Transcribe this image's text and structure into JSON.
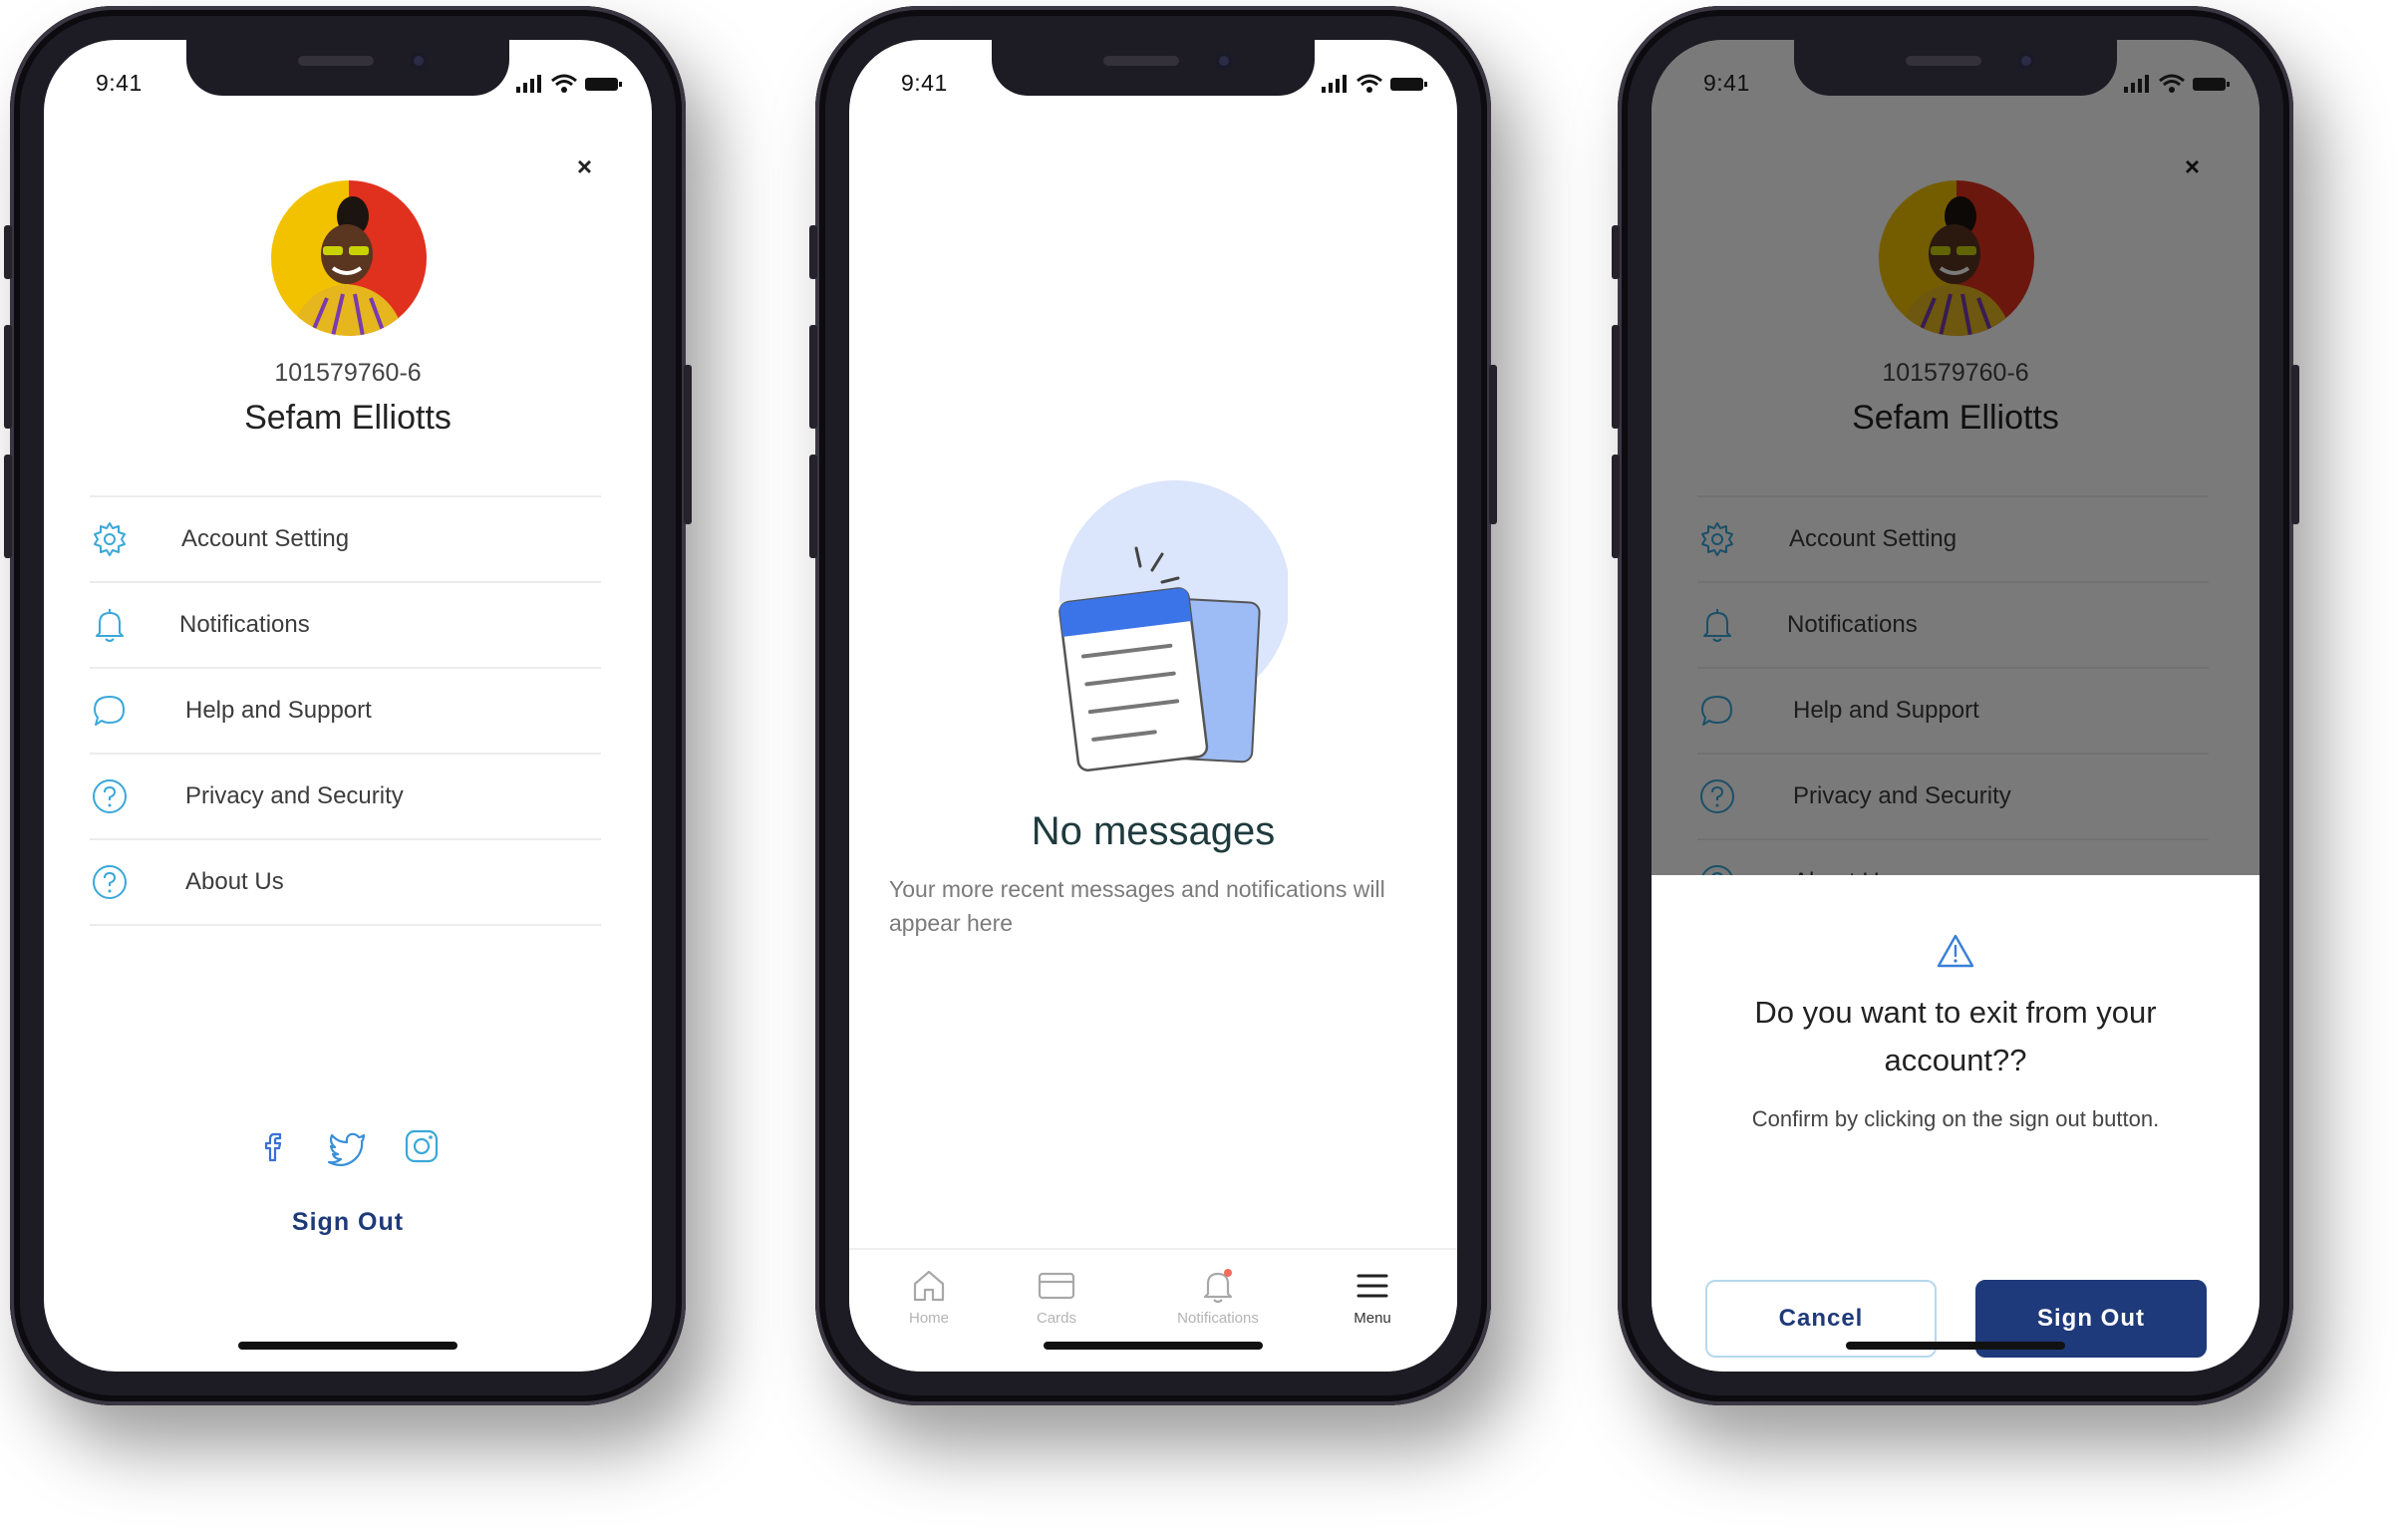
{
  "status_bar": {
    "time": "9:41"
  },
  "profile": {
    "account_number": "101579760-6",
    "name": "Sefam Elliotts",
    "close_label": "×",
    "menu": [
      {
        "label": "Account Setting",
        "icon": "gear-icon"
      },
      {
        "label": "Notifications",
        "icon": "bell-icon"
      },
      {
        "label": "Help and Support",
        "icon": "chat-bubble-icon"
      },
      {
        "label": "Privacy and Security",
        "icon": "question-circle-icon"
      },
      {
        "label": "About Us",
        "icon": "question-circle-icon"
      }
    ],
    "social": [
      "facebook-icon",
      "twitter-icon",
      "instagram-icon"
    ],
    "sign_out_label": "Sign Out"
  },
  "empty_state": {
    "title": "No messages",
    "description": "Your more recent messages and notifications will appear here"
  },
  "bottom_nav": {
    "items": [
      {
        "label": "Home",
        "icon": "home-icon",
        "active": false
      },
      {
        "label": "Cards",
        "icon": "card-icon",
        "active": false
      },
      {
        "label": "Notifications",
        "icon": "bell-icon",
        "active": false
      },
      {
        "label": "Menu",
        "icon": "hamburger-icon",
        "active": true
      }
    ]
  },
  "dialog": {
    "title": "Do you want to exit from your account??",
    "message": "Confirm by clicking on the sign out button.",
    "cancel_label": "Cancel",
    "confirm_label": "Sign Out"
  },
  "colors": {
    "primary": "#1e3a7a",
    "accent_icon": "#3aa8d8",
    "illustration_circle": "#dbe5fb",
    "illustration_blue": "#3b74e8"
  }
}
